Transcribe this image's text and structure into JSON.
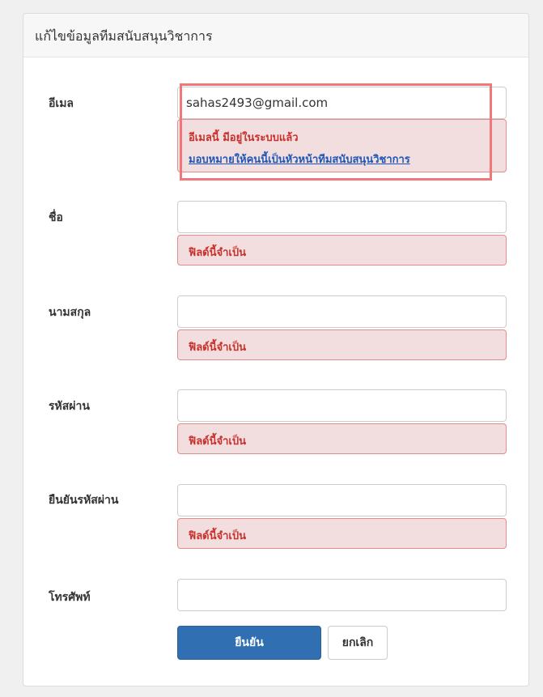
{
  "form": {
    "title": "แก้ไขข้อมูลทีมสนับสนุนวิชาการ",
    "fields": {
      "email": {
        "label": "อีเมล",
        "value": "sahas2493@gmail.com",
        "error": "อีเมลนี้ มีอยู่ในระบบแล้ว",
        "error_link": "มอบหมายให้คนนี้เป็นหัวหน้าทีมสนับสนุนวิชาการ"
      },
      "first_name": {
        "label": "ชื่อ",
        "value": "",
        "error": "ฟิลด์นี้จำเป็น"
      },
      "last_name": {
        "label": "นามสกุล",
        "value": "",
        "error": "ฟิลด์นี้จำเป็น"
      },
      "password": {
        "label": "รหัสผ่าน",
        "value": "",
        "error": "ฟิลด์นี้จำเป็น"
      },
      "confirm_password": {
        "label": "ยืนยันรหัสผ่าน",
        "value": "",
        "error": "ฟิลด์นี้จำเป็น"
      },
      "phone": {
        "label": "โทรศัพท์",
        "value": ""
      }
    },
    "buttons": {
      "submit": "ยืนยัน",
      "cancel": "ยกเลิก"
    }
  },
  "colors": {
    "primary": "#2f6fb2",
    "error_text": "#c9302c",
    "error_bg": "#f2dede",
    "highlight": "#f0787a",
    "link": "#1f57b8"
  }
}
